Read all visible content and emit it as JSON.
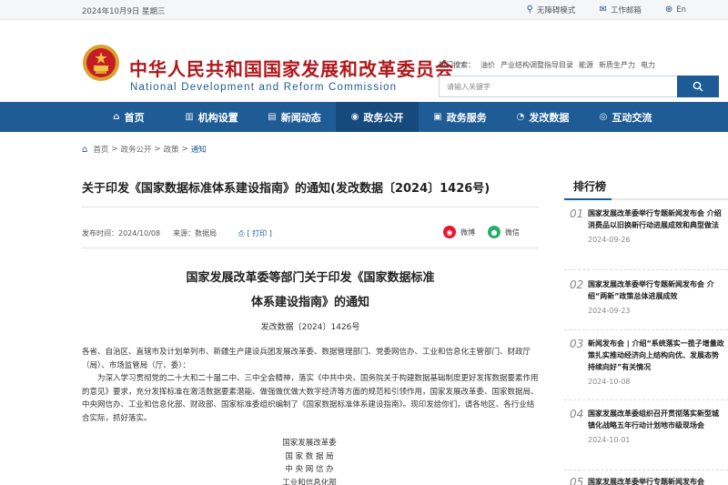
{
  "topbar": {
    "date": "2024年10月9日 星期三",
    "tools": [
      {
        "label": "无障碍模式",
        "icon": "location-icon"
      },
      {
        "label": "工作邮箱",
        "icon": "mail-icon"
      },
      {
        "label": "En",
        "icon": "globe-icon"
      }
    ]
  },
  "header": {
    "site_name_cn": "中华人民共和国国家发展和改革委员会",
    "site_name_en": "National Development and Reform Commission",
    "hot_label": "热门搜索：",
    "hot_terms": [
      "油价",
      "产业结构调整指导目录",
      "能源",
      "新质生产力",
      "电力"
    ],
    "search_placeholder": "请输入关键字"
  },
  "nav": [
    {
      "label": "首页",
      "icon": "home-icon"
    },
    {
      "label": "机构设置",
      "icon": "building-icon"
    },
    {
      "label": "新闻动态",
      "icon": "news-icon"
    },
    {
      "label": "政务公开",
      "icon": "eye-icon",
      "active": true
    },
    {
      "label": "政务服务",
      "icon": "service-icon"
    },
    {
      "label": "发改数据",
      "icon": "chart-icon"
    },
    {
      "label": "互动交流",
      "icon": "chat-icon"
    }
  ],
  "breadcrumb": [
    "首页",
    "政务公开",
    "政策",
    "通知"
  ],
  "article": {
    "title": "关于印发《国家数据标准体系建设指南》的通知(发改数据〔2024〕1426号)",
    "publish_label": "发布时间：",
    "publish_date": "2024/10/08",
    "source_label": "来源：",
    "source": "数据局",
    "print_label": "[ 打印 ]",
    "share": [
      {
        "label": "微博",
        "color": "#e6162d"
      },
      {
        "label": "微信",
        "color": "#2aae67"
      }
    ],
    "heading_line1": "国家发展改革委等部门关于印发《国家数据标准",
    "heading_line2": "体系建设指南》的通知",
    "doc_number": "发改数据〔2024〕1426号",
    "addressee": "各省、自治区、直辖市及计划单列市、新疆生产建设兵团发展改革委、数据管理部门、党委网信办、工业和信息化主管部门、财政厅（局）、市场监管局（厅、委）：",
    "paragraph": "为深入学习贯彻党的二十大和二十届二中、三中全会精神，落实《中共中央、国务院关于构建数据基础制度更好发挥数据要素作用的意见》要求，充分发挥标准在激活数据要素潜能、做强做优做大数字经济等方面的规范和引领作用，国家发展改革委、国家数据局、中央网信办、工业和信息化部、财政部、国家标准委组织编制了《国家数据标准体系建设指南》。现印发给你们，请各地区、各行业结合实际，抓好落实。",
    "signatories": [
      "国家发展改革委",
      "国 家 数 据 局",
      "中 央 网 信 办",
      "工业和信息化部"
    ]
  },
  "ranking": {
    "title": "排行榜",
    "items": [
      {
        "num": "01",
        "text": "国家发展改革委举行专题新闻发布会 介绍消费品以旧换新行动进展成效和典型做法",
        "date": "2024-09-26"
      },
      {
        "num": "02",
        "text": "国家发展改革委举行专题新闻发布会 介绍“两新”政策总体进展成效",
        "date": "2024-09-23"
      },
      {
        "num": "03",
        "text": "新闻发布会 | 介绍“系统落实一揽子增量政策扎实推动经济向上结构向优、发展态势持续向好”有关情况",
        "date": "2024-10-08"
      },
      {
        "num": "04",
        "text": "国家发展改革委组织召开贯彻落实新型城镇化战略五年行动计划地市级现场会",
        "date": "2024-10-01"
      },
      {
        "num": "05",
        "text": "国家发展改革委举行专题新闻发布会",
        "date": ""
      }
    ]
  }
}
